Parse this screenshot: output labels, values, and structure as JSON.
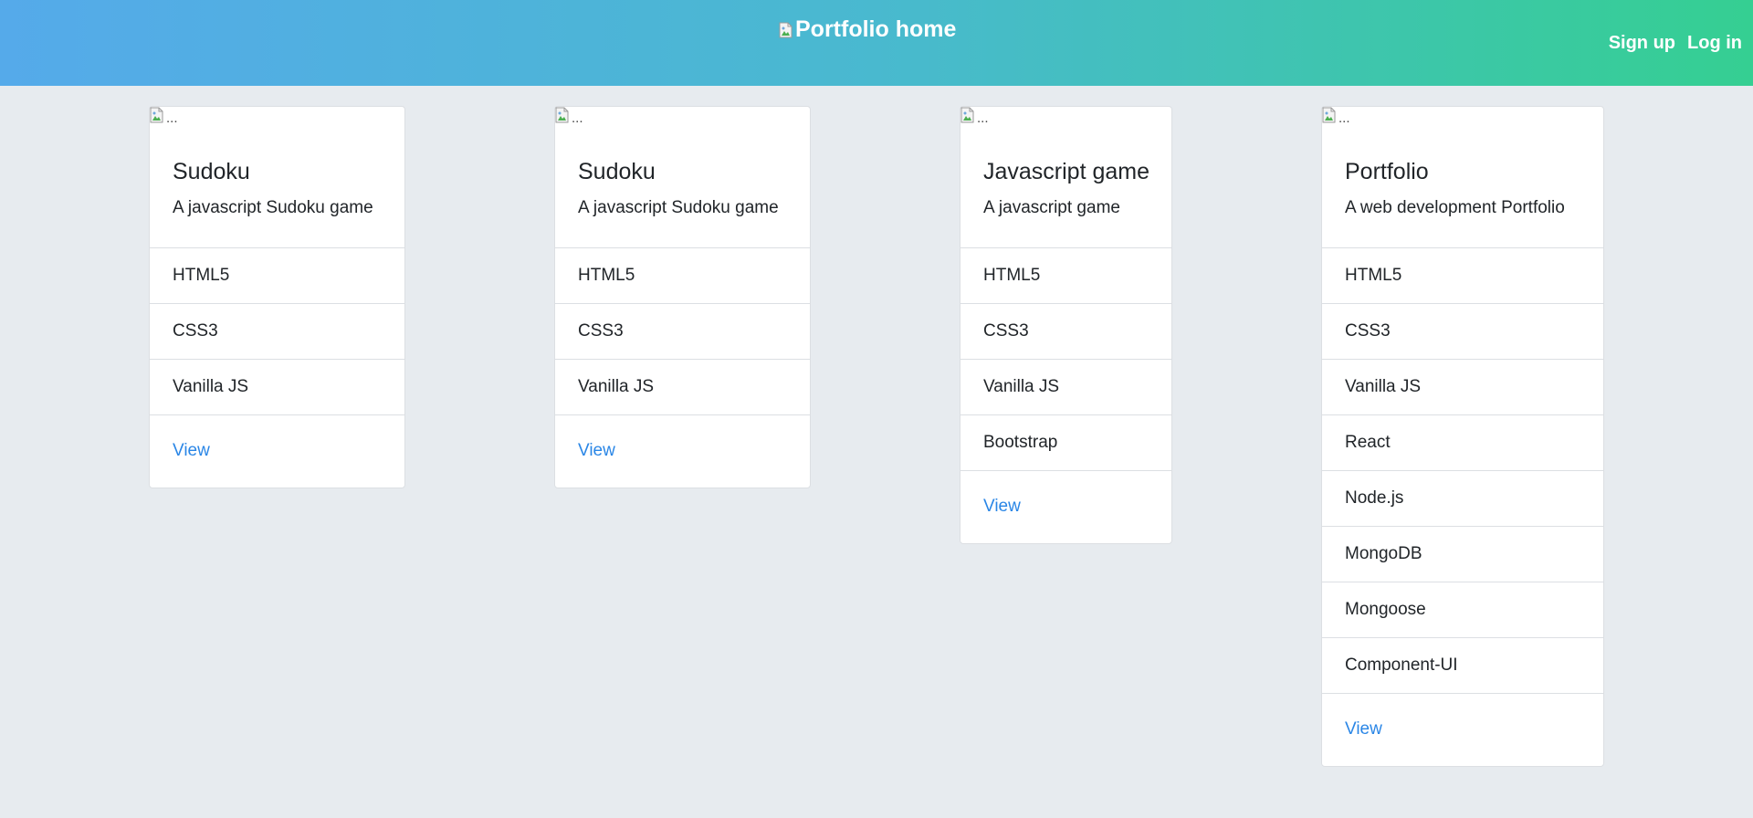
{
  "navbar": {
    "brand_label": "Portfolio home",
    "links": [
      "Sign up",
      "Log in"
    ]
  },
  "cards": [
    {
      "img_alt": "...",
      "title": "Sudoku",
      "text": "A javascript Sudoku game",
      "items": [
        "HTML5",
        "CSS3",
        "Vanilla JS"
      ],
      "link_label": "View"
    },
    {
      "img_alt": "...",
      "title": "Sudoku",
      "text": "A javascript Sudoku game",
      "items": [
        "HTML5",
        "CSS3",
        "Vanilla JS"
      ],
      "link_label": "View"
    },
    {
      "img_alt": "...",
      "title": "Javascript game",
      "text": "A javascript game",
      "items": [
        "HTML5",
        "CSS3",
        "Vanilla JS",
        "Bootstrap"
      ],
      "link_label": "View"
    },
    {
      "img_alt": "...",
      "title": "Portfolio",
      "text": "A web development Portfolio",
      "items": [
        "HTML5",
        "CSS3",
        "Vanilla JS",
        "React",
        "Node.js",
        "MongoDB",
        "Mongoose",
        "Component-UI"
      ],
      "link_label": "View"
    }
  ],
  "colors": {
    "link": "#2a86e6",
    "page_background": "#e7ebef",
    "navbar_gradient_start": "#55aaea",
    "navbar_gradient_end": "#35cf92"
  },
  "icons": {
    "image_placeholder": "broken-image-icon"
  }
}
